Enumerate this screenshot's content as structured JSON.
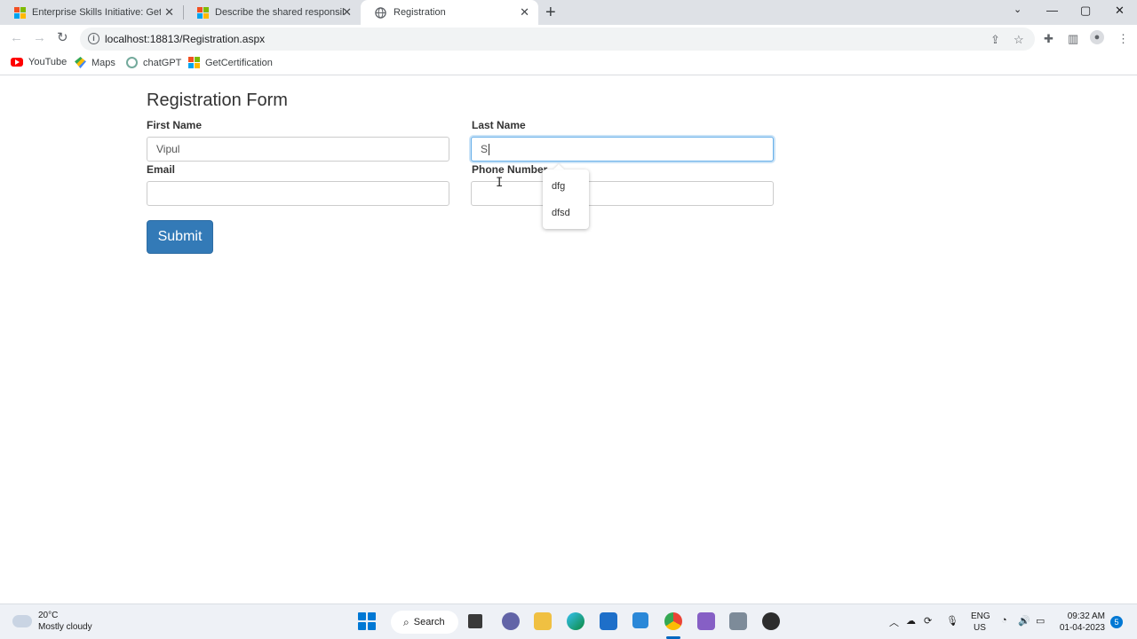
{
  "browser": {
    "tabs": [
      {
        "title": "Enterprise Skills Initiative: GetCer",
        "favicon": "microsoft-icon"
      },
      {
        "title": "Describe the shared responsibiliti",
        "favicon": "microsoft-icon"
      },
      {
        "title": "Registration",
        "favicon": "globe-icon",
        "active": true
      }
    ],
    "url": "localhost:18813/Registration.aspx",
    "bookmarks": [
      {
        "label": "YouTube",
        "icon": "youtube-icon"
      },
      {
        "label": "Maps",
        "icon": "maps-icon"
      },
      {
        "label": "chatGPT",
        "icon": "chatgpt-icon"
      },
      {
        "label": "GetCertification",
        "icon": "microsoft-icon"
      }
    ]
  },
  "form": {
    "title": "Registration Form",
    "first_name_label": "First Name",
    "first_name_value": "Vipul",
    "last_name_label": "Last Name",
    "last_name_value": "S",
    "email_label": "Email",
    "email_value": "",
    "phone_label": "Phone Number",
    "phone_value": "",
    "submit_label": "Submit",
    "autocomplete": [
      "dfg",
      "dfsd"
    ]
  },
  "taskbar": {
    "temperature": "20°C",
    "weather": "Mostly cloudy",
    "search_label": "Search",
    "lang_line1": "ENG",
    "lang_line2": "US",
    "time": "09:32 AM",
    "date": "01-04-2023",
    "notification_count": "5"
  },
  "colors": {
    "primary_button": "#337ab7",
    "focus_border": "#66afe9",
    "tab_strip": "#dee1e6"
  }
}
